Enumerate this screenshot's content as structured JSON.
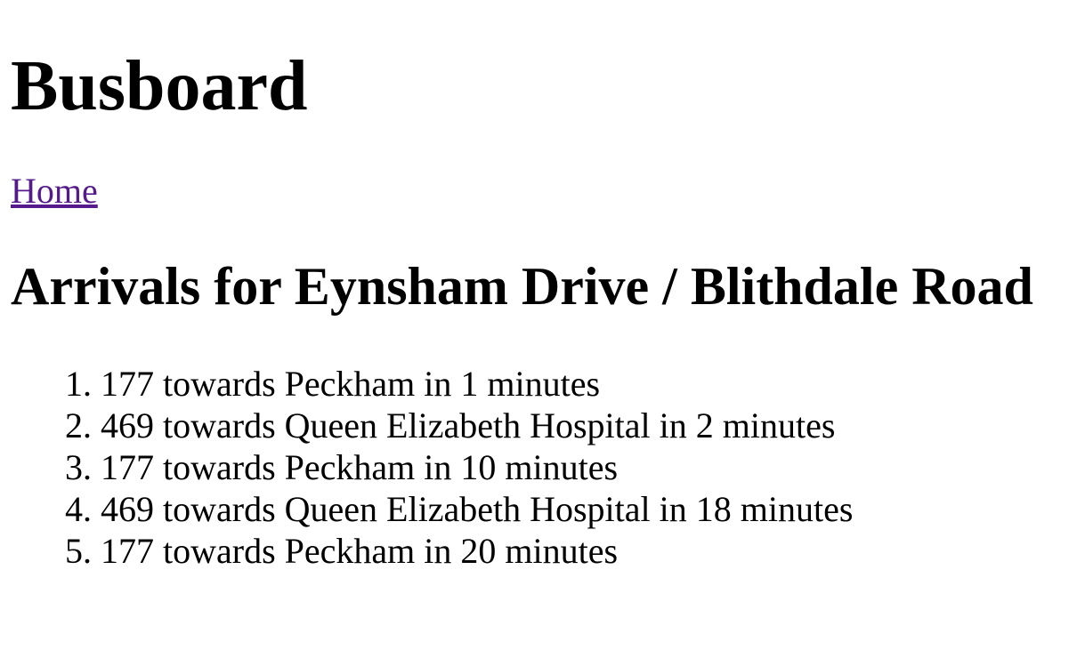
{
  "header": {
    "title": "Busboard"
  },
  "nav": {
    "home_label": "Home"
  },
  "main": {
    "heading": "Arrivals for Eynsham Drive / Blithdale Road",
    "arrivals": [
      "177 towards Peckham in 1 minutes",
      "469 towards Queen Elizabeth Hospital in 2 minutes",
      "177 towards Peckham in 10 minutes",
      "469 towards Queen Elizabeth Hospital in 18 minutes",
      "177 towards Peckham in 20 minutes"
    ]
  }
}
